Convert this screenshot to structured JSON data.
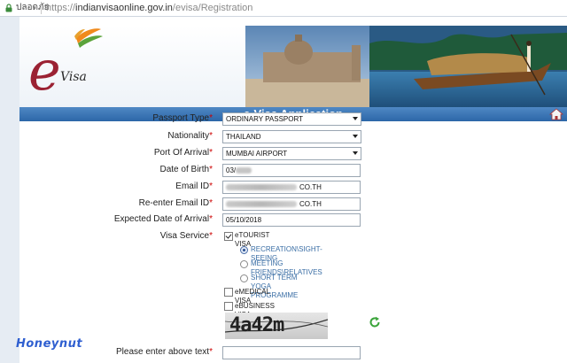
{
  "browser": {
    "secure_label": "ปลอดภัย",
    "url_scheme": "https://",
    "url_host": "indianvisaonline.gov.in",
    "url_path": "/evisa/Registration"
  },
  "header": {
    "logo_letter": "e",
    "logo_word": "Visa",
    "title": "e-Visa Application"
  },
  "form": {
    "passport_type": {
      "label": "Passport Type",
      "value": "ORDINARY PASSPORT"
    },
    "nationality": {
      "label": "Nationality",
      "value": "THAILAND"
    },
    "port_of_arrival": {
      "label": "Port Of Arrival",
      "value": "MUMBAI AIRPORT"
    },
    "date_of_birth": {
      "label": "Date of Birth",
      "value": "03/"
    },
    "email": {
      "label": "Email ID",
      "value_suffix": "CO.TH"
    },
    "email_confirm": {
      "label": "Re-enter Email ID",
      "value_suffix": "CO.TH"
    },
    "expected_arrival": {
      "label": "Expected Date of Arrival",
      "value": "05/10/2018"
    },
    "visa_service": {
      "label": "Visa Service",
      "etourist": {
        "label": "eTOURIST VISA",
        "checked": true
      },
      "tourist_options": [
        {
          "label": "RECREATION\\SIGHT-SEEING",
          "selected": true
        },
        {
          "label": "MEETING FRIENDS\\RELATIVES",
          "selected": false
        },
        {
          "label": "SHORT TERM YOGA PROGRAMME",
          "selected": false
        }
      ],
      "emedical": {
        "label": "eMEDICAL VISA",
        "checked": false
      },
      "ebusiness": {
        "label": "eBUSINESS VISA",
        "checked": false
      }
    },
    "captcha": {
      "text": "4a42m",
      "label": "Please enter above text",
      "value": ""
    }
  },
  "required_mark": "*",
  "watermark": "Honeynut",
  "colors": {
    "title_bar": "#2c67a8",
    "required": "#cc0000",
    "radio_label": "#3a6ea5",
    "refresh_icon": "#3aa43a"
  }
}
